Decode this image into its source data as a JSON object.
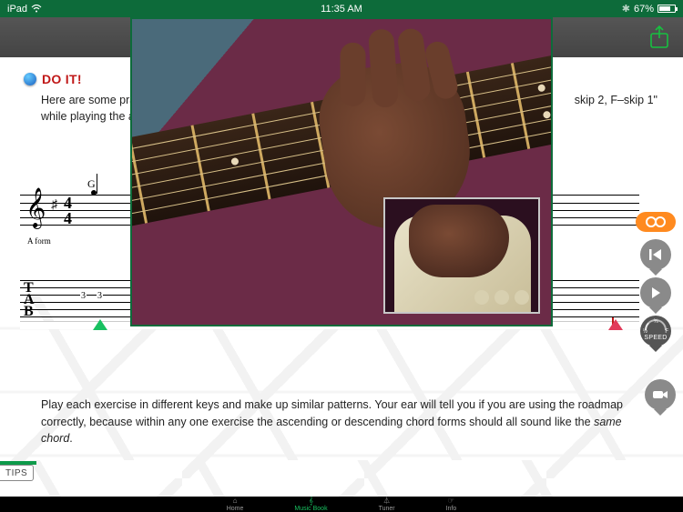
{
  "status_bar": {
    "device": "iPad",
    "time": "11:35 AM",
    "bluetooth": "✱",
    "battery_pct": "67%"
  },
  "heading": {
    "pin": "📍",
    "title": "DO IT!",
    "line1_left": "Here are some pra",
    "line2_left": "while playing the a",
    "line1_right": "skip 2, F–skip 1\""
  },
  "score": {
    "chord": "G",
    "form": "A form",
    "time_top": "4",
    "time_bot": "4",
    "tab_letters": [
      "T",
      "A",
      "B"
    ],
    "tab_num_a": "3",
    "tab_num_b": "3"
  },
  "controls": {
    "loop": "loop",
    "restart": "restart",
    "play": "play",
    "speed_caption": "SPEED",
    "speed_half": "½",
    "speed_threeq": "¾",
    "speed_full": "F",
    "camera": "camera"
  },
  "paragraph": {
    "p1": "Play each exercise in different keys and make up similar patterns. Your ear will tell you if you are using the roadmap correctly, because within any one exercise the ascending or descending chord forms should all sound like the ",
    "em": "same chord",
    "tail": "."
  },
  "tips_label": "TIPS",
  "tabbar": {
    "home": "Home",
    "book": "Music Book",
    "tuner": "Tuner",
    "info": "Info"
  }
}
